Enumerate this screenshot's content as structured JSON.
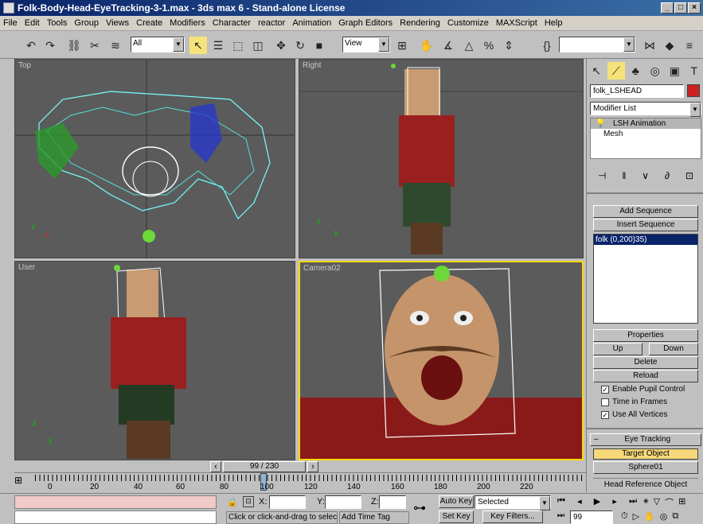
{
  "window": {
    "title": "Folk-Body-Head-EyeTracking-3-1.max - 3ds max 6 - Stand-alone License",
    "controls": [
      "_",
      "□",
      "×"
    ]
  },
  "menu": [
    "File",
    "Edit",
    "Tools",
    "Group",
    "Views",
    "Create",
    "Modifiers",
    "Character",
    "reactor",
    "Animation",
    "Graph Editors",
    "Rendering",
    "Customize",
    "MAXScript",
    "Help"
  ],
  "toolbar": {
    "selection_filter": "All",
    "ref_coord": "View",
    "named_sel": ""
  },
  "viewports": {
    "top": "Top",
    "right": "Right",
    "user": "User",
    "camera": "Camera02"
  },
  "command_panel": {
    "object_name": "folk_LSHEAD",
    "object_color": "#cc2222",
    "modifier_list": "Modifier List",
    "stack": [
      "LSH Animation",
      "Mesh"
    ],
    "buttons": {
      "add_sequence": "Add Sequence",
      "insert_sequence": "Insert Sequence",
      "properties": "Properties",
      "up": "Up",
      "down": "Down",
      "delete": "Delete",
      "reload": "Reload"
    },
    "sequence_list": [
      "folk (0,200)35)"
    ],
    "checkboxes": [
      {
        "label": "Enable Pupil Control",
        "checked": true
      },
      {
        "label": "Time in Frames",
        "checked": false
      },
      {
        "label": "Use All Vertices",
        "checked": true
      }
    ],
    "eye_tracking": {
      "rollout": "Eye Tracking",
      "target_label": "Target Object",
      "target_value": "Sphere01",
      "head_ref": "Head Reference Object"
    }
  },
  "timeline": {
    "frame": "99 / 230",
    "ticks": [
      "0",
      "20",
      "40",
      "60",
      "80",
      "100",
      "120",
      "140",
      "160",
      "180",
      "200",
      "220"
    ]
  },
  "status": {
    "coord_x": "X:",
    "coord_y": "Y:",
    "coord_z": "Z:",
    "prompt": "Click or click-and-drag to select o",
    "add_time_tag": "Add Time Tag",
    "auto_key": "Auto Key",
    "selected": "Selected",
    "set_key": "Set Key",
    "key_filters": "Key Filters...",
    "current_frame": "99"
  }
}
